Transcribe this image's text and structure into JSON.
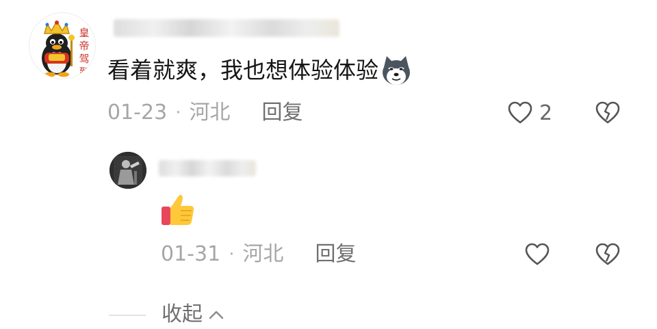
{
  "comment": {
    "text": "看着就爽，我也想体验体验",
    "emoji_icon": "husky-doge-emoji-icon",
    "date": "01-23",
    "location": "河北",
    "separator": "·",
    "reply_label": "回复",
    "like_count": "2",
    "avatar_side_text": "皇帝驾到"
  },
  "reply": {
    "emoji_icon": "thumbs-up-emoji-icon",
    "date": "01-31",
    "location": "河北",
    "separator": "·",
    "reply_label": "回复"
  },
  "collapse": {
    "label": "收起"
  },
  "colors": {
    "text_primary": "#161616",
    "text_meta": "#a6a6a6",
    "icon_stroke": "#555555"
  }
}
